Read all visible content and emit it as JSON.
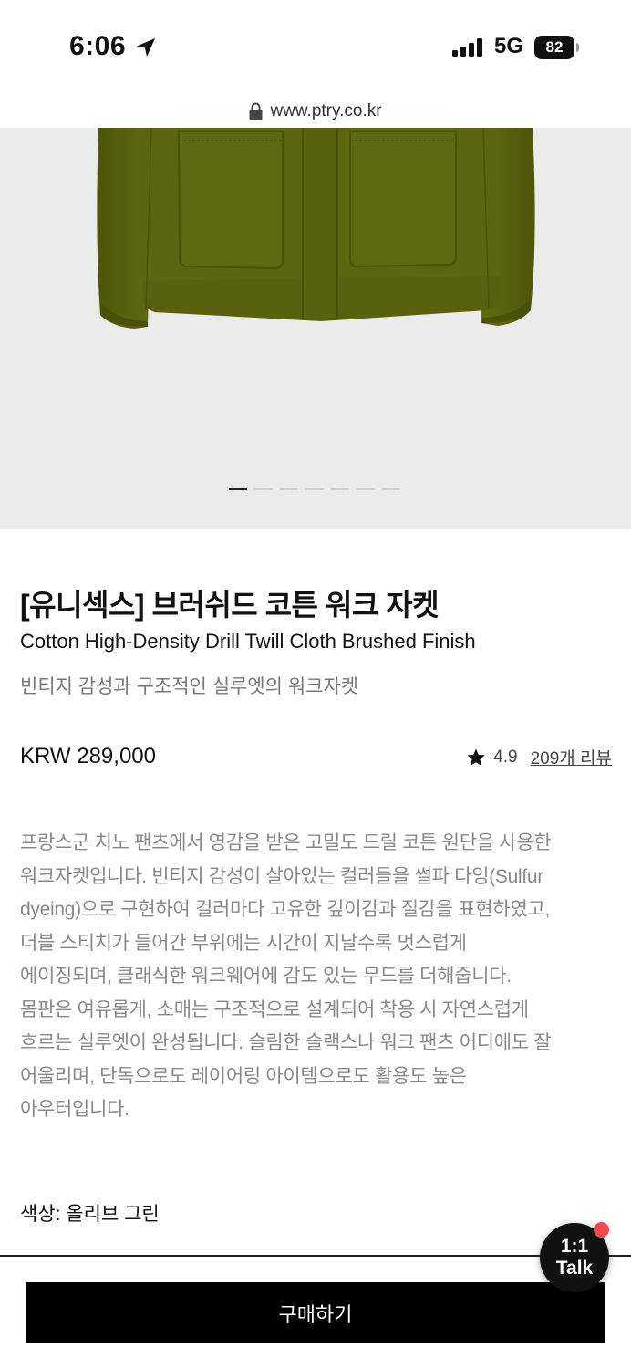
{
  "status_bar": {
    "time": "6:06",
    "network": "5G",
    "battery": "82"
  },
  "browser": {
    "url": "www.ptry.co.kr"
  },
  "gallery": {
    "slide_count": 7,
    "active_index": 0
  },
  "product": {
    "title": "[유니섹스] 브러쉬드 코튼 워크 자켓",
    "subtitle": "Cotton High-Density Drill Twill Cloth Brushed Finish",
    "tagline": "빈티지 감성과 구조적인 실루엣의 워크자켓",
    "price": "KRW 289,000",
    "rating": "4.9",
    "reviews_label": "209개 리뷰",
    "description_lines": [
      "프랑스군 치노 팬츠에서 영감을 받은 고밀도 드릴 코튼 원단을 사용한",
      "워크자켓입니다. 빈티지 감성이 살아있는 컬러들을 썰파 다잉(Sulfur",
      "dyeing)으로 구현하여 컬러마다 고유한 깊이감과 질감을 표현하였고,",
      "더블 스티치가 들어간 부위에는 시간이 지날수록 멋스럽게",
      "에이징되며, 클래식한 워크웨어에 감도 있는 무드를 더해줍니다.",
      "몸판은 여유롭게, 소매는 구조적으로 설계되어 착용 시 자연스럽게",
      "흐르는 실루엣이 완성됩니다. 슬림한 슬랙스나 워크 팬츠 어디에도 잘",
      "어울리며, 단독으로도 레이어링 아이템으로도 활용도 높은",
      "아우터입니다."
    ],
    "color_label": "색상: 올리브 그린"
  },
  "actions": {
    "buy_label": "구매하기",
    "talk_line1": "1:1",
    "talk_line2": "Talk"
  },
  "colors": {
    "jacket": "#5e6510",
    "hero_bg": "#ebebeb",
    "button_bg": "#000000",
    "badge": "#f04a4a"
  }
}
